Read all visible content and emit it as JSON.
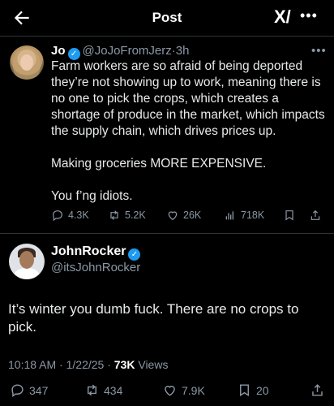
{
  "header": {
    "title": "Post",
    "logo_text": "X/",
    "more": "•••"
  },
  "tweet": {
    "name": "Jo",
    "handle": "@JoJoFromJerz",
    "time": "3h",
    "more": "•••",
    "text": "Farm workers are so afraid of being deported they’re not showing up to work, meaning there is no one to pick the crops, which creates a shortage of produce in the market, which impacts the supply chain, which drives prices up.\n\nMaking groceries MORE EXPENSIVE.\n\nYou f’ng idiots.",
    "stats": {
      "replies": "4.3K",
      "reposts": "5.2K",
      "likes": "26K",
      "views": "718K"
    }
  },
  "reply": {
    "name": "JohnRocker",
    "handle": "@itsJohnRocker",
    "text": "It’s winter you dumb fuck. There are no crops to pick.",
    "time": "10:18 AM",
    "date": "1/22/25",
    "views_count": "73K",
    "views_label": "Views",
    "stats": {
      "replies": "347",
      "reposts": "434",
      "likes": "7.9K",
      "bookmarks": "20"
    }
  },
  "colors": {
    "background": "#000000",
    "text": "#e7e9ea",
    "muted": "#8b98a5",
    "verified": "#1d9bf0",
    "divider": "#2f3336"
  }
}
